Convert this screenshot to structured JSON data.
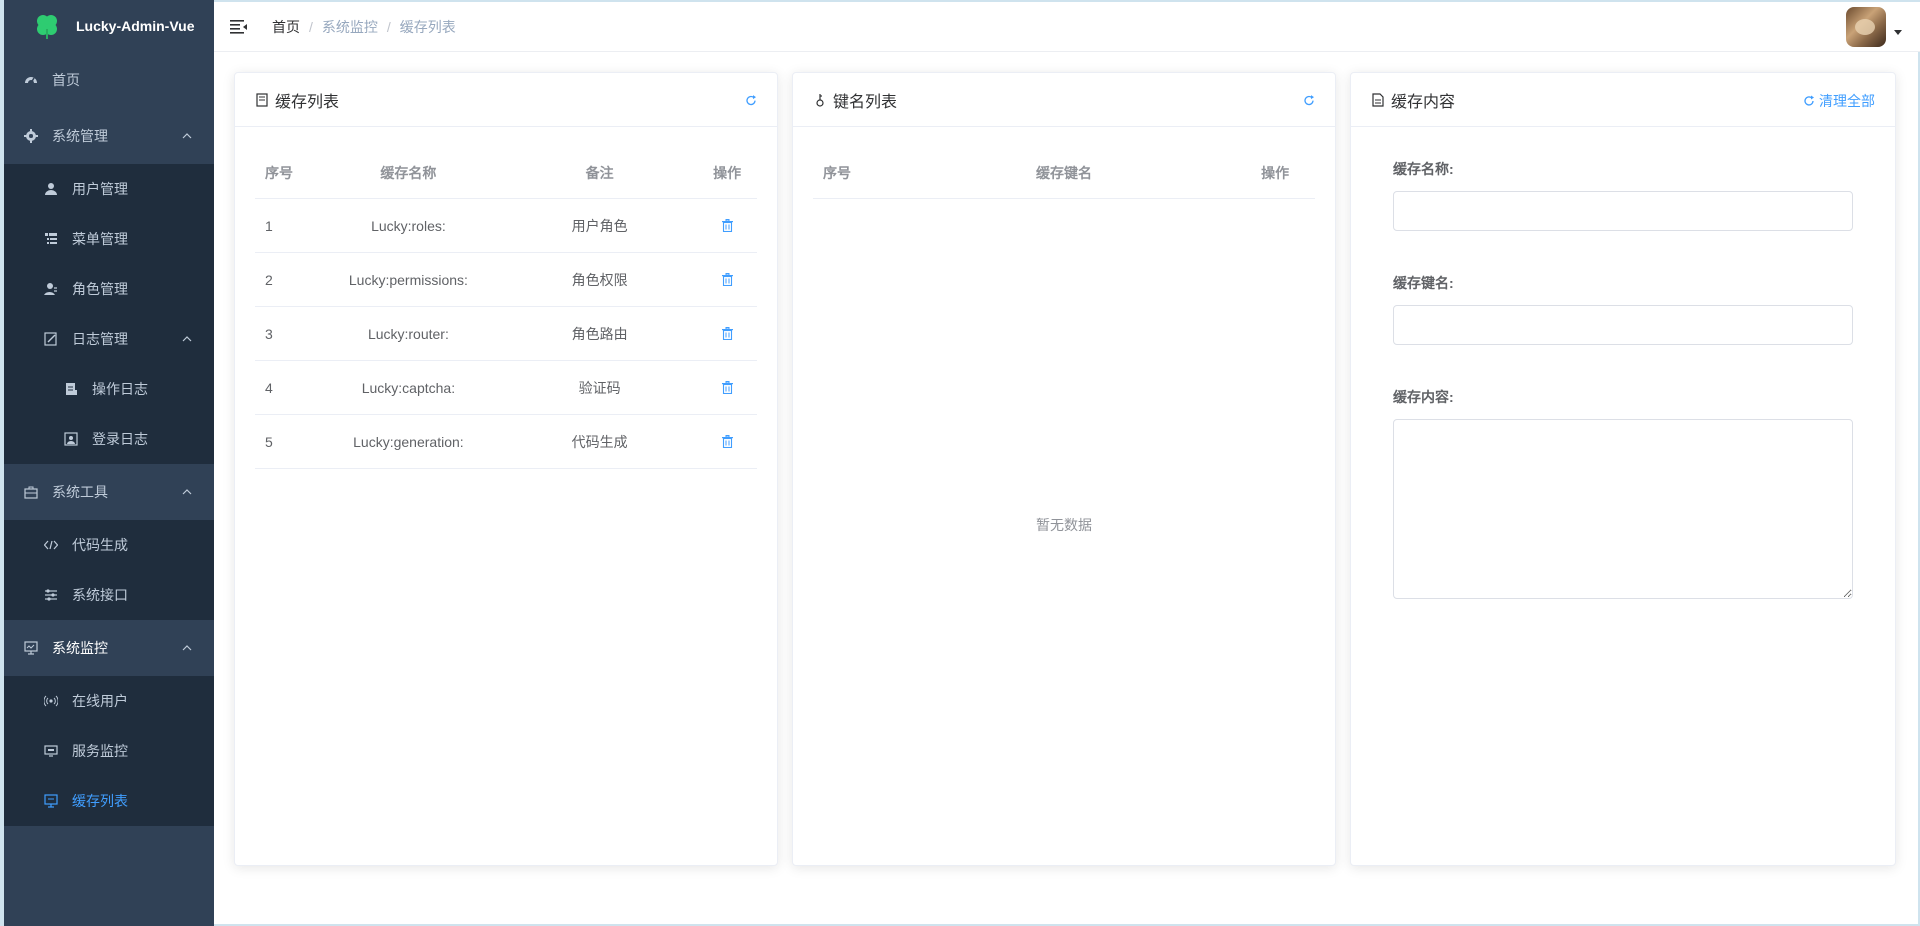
{
  "app": {
    "title": "Lucky-Admin-Vue",
    "brand_color": "#409eff"
  },
  "sidebar": {
    "home": "首页",
    "system": {
      "label": "系统管理",
      "users": "用户管理",
      "menus": "菜单管理",
      "roles": "角色管理",
      "logs": {
        "label": "日志管理",
        "operation": "操作日志",
        "login": "登录日志"
      }
    },
    "tools": {
      "label": "系统工具",
      "codegen": "代码生成",
      "api": "系统接口"
    },
    "monitor": {
      "label": "系统监控",
      "online": "在线用户",
      "server": "服务监控",
      "cache": "缓存列表"
    }
  },
  "header": {
    "breadcrumb": [
      "首页",
      "系统监控",
      "缓存列表"
    ]
  },
  "cache_list": {
    "title": "缓存列表",
    "columns": {
      "index": "序号",
      "name": "缓存名称",
      "remark": "备注",
      "action": "操作"
    },
    "rows": [
      {
        "index": "1",
        "name": "Lucky:roles:",
        "remark": "用户角色"
      },
      {
        "index": "2",
        "name": "Lucky:permissions:",
        "remark": "角色权限"
      },
      {
        "index": "3",
        "name": "Lucky:router:",
        "remark": "角色路由"
      },
      {
        "index": "4",
        "name": "Lucky:captcha:",
        "remark": "验证码"
      },
      {
        "index": "5",
        "name": "Lucky:generation:",
        "remark": "代码生成"
      }
    ]
  },
  "key_list": {
    "title": "键名列表",
    "columns": {
      "index": "序号",
      "key": "缓存键名",
      "action": "操作"
    },
    "empty": "暂无数据"
  },
  "cache_content": {
    "title": "缓存内容",
    "clear_all": "清理全部",
    "name_label": "缓存名称:",
    "name_value": "",
    "key_label": "缓存键名:",
    "key_value": "",
    "content_label": "缓存内容:",
    "content_value": ""
  }
}
